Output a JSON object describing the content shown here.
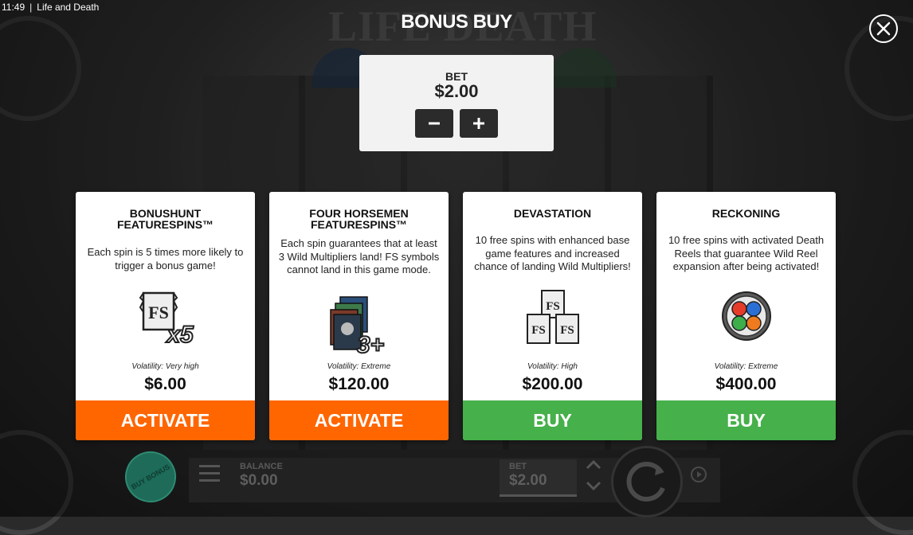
{
  "status_bar": {
    "time": "11:49",
    "app_title": "Life and Death"
  },
  "background": {
    "logo_text": "LIFE DEATH"
  },
  "header": {
    "title": "BONUS BUY",
    "close_icon": "close-icon"
  },
  "bet_panel": {
    "label": "BET",
    "value": "$2.00",
    "decrease_icon": "minus-icon",
    "increase_icon": "plus-icon"
  },
  "cards": [
    {
      "title": "BONUSHUNT\nFEATURESPINS™",
      "description": "Each spin is 5 times more likely to trigger a bonus game!",
      "image": "fs-x5-icon",
      "volatility": "Volatility: Very high",
      "price": "$6.00",
      "button": "ACTIVATE",
      "button_color": "#ff6600"
    },
    {
      "title": "FOUR HORSEMEN\nFEATURESPINS™",
      "description": "Each spin guarantees that at least 3 Wild Multipliers land! FS symbols cannot land in this game mode.",
      "image": "horsemen-3plus-icon",
      "volatility": "Volatility: Extreme",
      "price": "$120.00",
      "button": "ACTIVATE",
      "button_color": "#ff6600"
    },
    {
      "title": "DEVASTATION",
      "description": "10 free spins with enhanced base game features and increased chance of landing Wild Multipliers!",
      "image": "fs-triple-icon",
      "volatility": "Volatility: High",
      "price": "$200.00",
      "button": "BUY",
      "button_color": "#46b04a"
    },
    {
      "title": "RECKONING",
      "description": "10 free spins with activated Death Reels that guarantee Wild Reel expansion after being activated!",
      "image": "stained-glass-rose-icon",
      "volatility": "Volatility: Extreme",
      "price": "$400.00",
      "button": "BUY",
      "button_color": "#46b04a"
    }
  ],
  "bottom_bar": {
    "buy_bonus": "BUY BONUS",
    "balance_label": "BALANCE",
    "balance_value": "$0.00",
    "bet_label": "BET",
    "bet_value": "$2.00"
  }
}
